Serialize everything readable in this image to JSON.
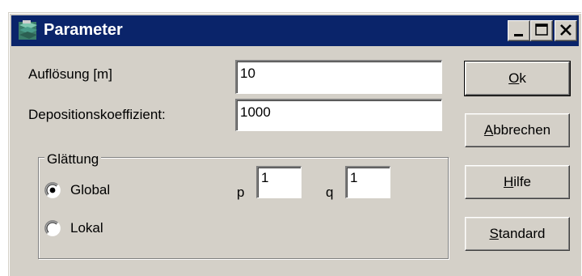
{
  "window": {
    "title": "Parameter"
  },
  "icons": {
    "app": "map-layers-icon",
    "minimize": "minimize-icon",
    "maximize": "maximize-icon",
    "close": "close-icon"
  },
  "form": {
    "resolution_label": "Auflösung [m]",
    "resolution_value": "10",
    "deposition_label": "Depositionskoeffizient:",
    "deposition_value": "1000"
  },
  "smoothing": {
    "group_label": "Glättung",
    "options": [
      {
        "label": "Global",
        "selected": true
      },
      {
        "label": "Lokal",
        "selected": false
      }
    ],
    "p_label": "p",
    "p_value": "1",
    "q_label": "q",
    "q_value": "1"
  },
  "buttons": {
    "ok": {
      "mnemonic": "O",
      "rest": "k"
    },
    "cancel": {
      "mnemonic": "A",
      "rest": "bbrechen"
    },
    "help": {
      "mnemonic": "H",
      "rest": "ilfe"
    },
    "standard": {
      "mnemonic": "S",
      "rest": "tandard"
    }
  },
  "colors": {
    "titlebar": "#0a246a",
    "face": "#d4d0c8",
    "title_text": "#ffffff"
  }
}
